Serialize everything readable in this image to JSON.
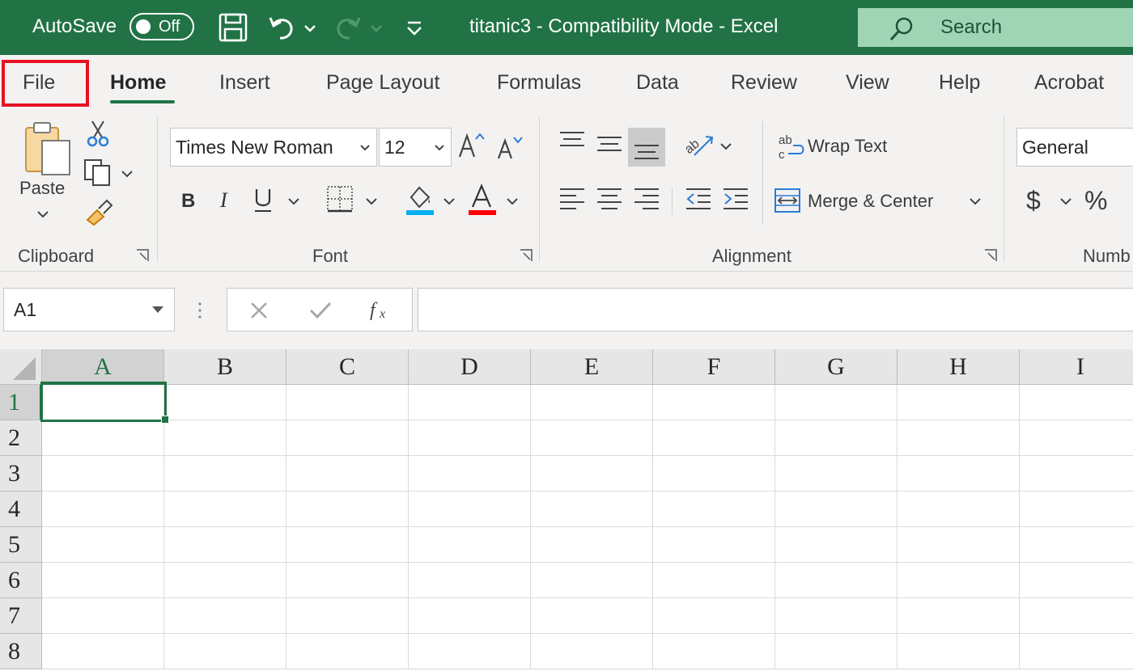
{
  "titlebar": {
    "autosave_label": "AutoSave",
    "autosave_state": "Off",
    "title": "titanic3  -  Compatibility Mode  -  Excel",
    "search_label": "Search"
  },
  "tabs": [
    "File",
    "Home",
    "Insert",
    "Page Layout",
    "Formulas",
    "Data",
    "Review",
    "View",
    "Help",
    "Acrobat"
  ],
  "ribbon": {
    "clipboard": {
      "paste_label": "Paste",
      "group_label": "Clipboard"
    },
    "font": {
      "font_name": "Times New Roman",
      "font_size": "12",
      "group_label": "Font"
    },
    "alignment": {
      "wrap_text_label": "Wrap Text",
      "merge_center_label": "Merge & Center",
      "group_label": "Alignment"
    },
    "number": {
      "format": "General",
      "group_label": "Numb",
      "currency_symbol": "$",
      "percent_symbol": "%"
    },
    "colors": {
      "fill_color": "#00b0f0",
      "font_color": "#ff0000"
    }
  },
  "formula_bar": {
    "name_box": "A1",
    "formula": ""
  },
  "grid": {
    "columns": [
      "A",
      "B",
      "C",
      "D",
      "E",
      "F",
      "G",
      "H",
      "I"
    ],
    "rows": [
      "1",
      "2",
      "3",
      "4",
      "5",
      "6",
      "7",
      "8"
    ],
    "active_cell": "A1"
  },
  "colors": {
    "accent": "#217346",
    "highlight": "#e81123"
  }
}
